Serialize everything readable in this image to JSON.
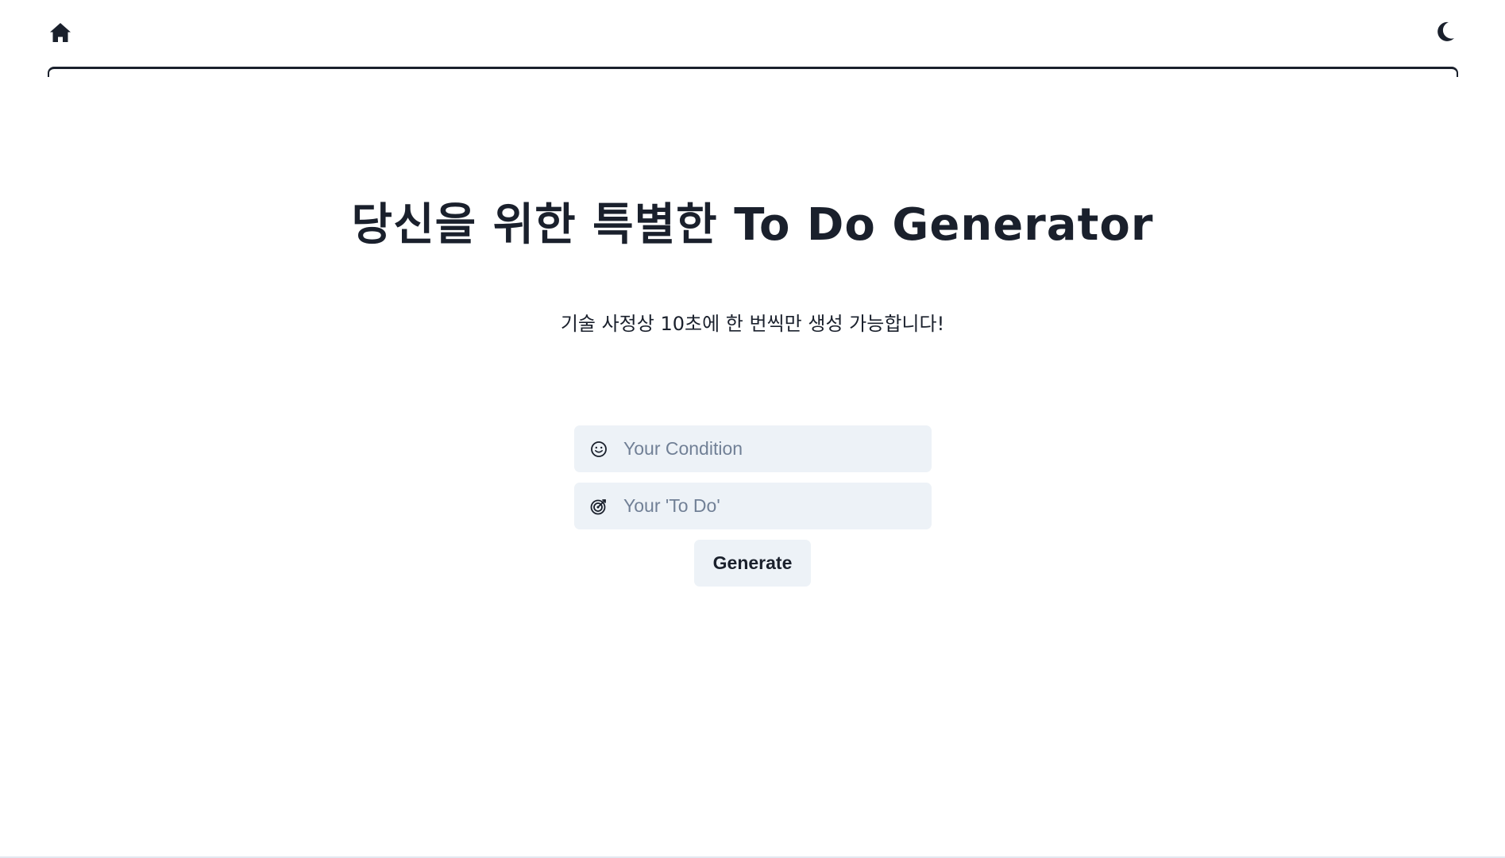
{
  "header": {
    "home_icon": "home-icon",
    "theme_icon": "moon-icon"
  },
  "main": {
    "title": "당신을 위한 특별한 To Do Generator",
    "subtitle": "기술 사정상 10초에 한 번씩만 생성 가능합니다!"
  },
  "form": {
    "condition": {
      "icon": "smile-icon",
      "placeholder": "Your Condition",
      "value": ""
    },
    "todo": {
      "icon": "target-icon",
      "placeholder": "Your 'To Do'",
      "value": ""
    },
    "generate_label": "Generate"
  },
  "colors": {
    "text": "#1a202c",
    "input_bg": "#edf2f7",
    "placeholder": "#718096"
  }
}
